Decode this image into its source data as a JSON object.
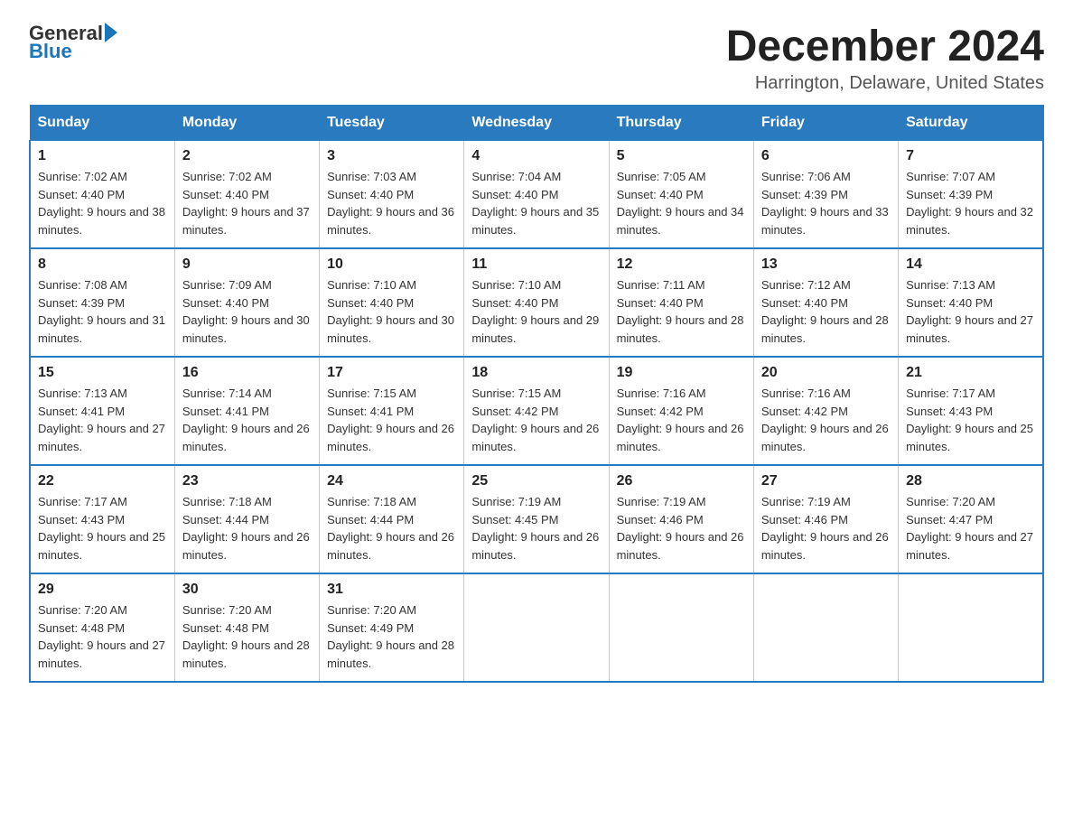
{
  "header": {
    "logo_general": "General",
    "logo_blue": "Blue",
    "month_title": "December 2024",
    "location": "Harrington, Delaware, United States"
  },
  "days_of_week": [
    "Sunday",
    "Monday",
    "Tuesday",
    "Wednesday",
    "Thursday",
    "Friday",
    "Saturday"
  ],
  "weeks": [
    [
      {
        "day": "1",
        "sunrise": "7:02 AM",
        "sunset": "4:40 PM",
        "daylight": "9 hours and 38 minutes."
      },
      {
        "day": "2",
        "sunrise": "7:02 AM",
        "sunset": "4:40 PM",
        "daylight": "9 hours and 37 minutes."
      },
      {
        "day": "3",
        "sunrise": "7:03 AM",
        "sunset": "4:40 PM",
        "daylight": "9 hours and 36 minutes."
      },
      {
        "day": "4",
        "sunrise": "7:04 AM",
        "sunset": "4:40 PM",
        "daylight": "9 hours and 35 minutes."
      },
      {
        "day": "5",
        "sunrise": "7:05 AM",
        "sunset": "4:40 PM",
        "daylight": "9 hours and 34 minutes."
      },
      {
        "day": "6",
        "sunrise": "7:06 AM",
        "sunset": "4:39 PM",
        "daylight": "9 hours and 33 minutes."
      },
      {
        "day": "7",
        "sunrise": "7:07 AM",
        "sunset": "4:39 PM",
        "daylight": "9 hours and 32 minutes."
      }
    ],
    [
      {
        "day": "8",
        "sunrise": "7:08 AM",
        "sunset": "4:39 PM",
        "daylight": "9 hours and 31 minutes."
      },
      {
        "day": "9",
        "sunrise": "7:09 AM",
        "sunset": "4:40 PM",
        "daylight": "9 hours and 30 minutes."
      },
      {
        "day": "10",
        "sunrise": "7:10 AM",
        "sunset": "4:40 PM",
        "daylight": "9 hours and 30 minutes."
      },
      {
        "day": "11",
        "sunrise": "7:10 AM",
        "sunset": "4:40 PM",
        "daylight": "9 hours and 29 minutes."
      },
      {
        "day": "12",
        "sunrise": "7:11 AM",
        "sunset": "4:40 PM",
        "daylight": "9 hours and 28 minutes."
      },
      {
        "day": "13",
        "sunrise": "7:12 AM",
        "sunset": "4:40 PM",
        "daylight": "9 hours and 28 minutes."
      },
      {
        "day": "14",
        "sunrise": "7:13 AM",
        "sunset": "4:40 PM",
        "daylight": "9 hours and 27 minutes."
      }
    ],
    [
      {
        "day": "15",
        "sunrise": "7:13 AM",
        "sunset": "4:41 PM",
        "daylight": "9 hours and 27 minutes."
      },
      {
        "day": "16",
        "sunrise": "7:14 AM",
        "sunset": "4:41 PM",
        "daylight": "9 hours and 26 minutes."
      },
      {
        "day": "17",
        "sunrise": "7:15 AM",
        "sunset": "4:41 PM",
        "daylight": "9 hours and 26 minutes."
      },
      {
        "day": "18",
        "sunrise": "7:15 AM",
        "sunset": "4:42 PM",
        "daylight": "9 hours and 26 minutes."
      },
      {
        "day": "19",
        "sunrise": "7:16 AM",
        "sunset": "4:42 PM",
        "daylight": "9 hours and 26 minutes."
      },
      {
        "day": "20",
        "sunrise": "7:16 AM",
        "sunset": "4:42 PM",
        "daylight": "9 hours and 26 minutes."
      },
      {
        "day": "21",
        "sunrise": "7:17 AM",
        "sunset": "4:43 PM",
        "daylight": "9 hours and 25 minutes."
      }
    ],
    [
      {
        "day": "22",
        "sunrise": "7:17 AM",
        "sunset": "4:43 PM",
        "daylight": "9 hours and 25 minutes."
      },
      {
        "day": "23",
        "sunrise": "7:18 AM",
        "sunset": "4:44 PM",
        "daylight": "9 hours and 26 minutes."
      },
      {
        "day": "24",
        "sunrise": "7:18 AM",
        "sunset": "4:44 PM",
        "daylight": "9 hours and 26 minutes."
      },
      {
        "day": "25",
        "sunrise": "7:19 AM",
        "sunset": "4:45 PM",
        "daylight": "9 hours and 26 minutes."
      },
      {
        "day": "26",
        "sunrise": "7:19 AM",
        "sunset": "4:46 PM",
        "daylight": "9 hours and 26 minutes."
      },
      {
        "day": "27",
        "sunrise": "7:19 AM",
        "sunset": "4:46 PM",
        "daylight": "9 hours and 26 minutes."
      },
      {
        "day": "28",
        "sunrise": "7:20 AM",
        "sunset": "4:47 PM",
        "daylight": "9 hours and 27 minutes."
      }
    ],
    [
      {
        "day": "29",
        "sunrise": "7:20 AM",
        "sunset": "4:48 PM",
        "daylight": "9 hours and 27 minutes."
      },
      {
        "day": "30",
        "sunrise": "7:20 AM",
        "sunset": "4:48 PM",
        "daylight": "9 hours and 28 minutes."
      },
      {
        "day": "31",
        "sunrise": "7:20 AM",
        "sunset": "4:49 PM",
        "daylight": "9 hours and 28 minutes."
      },
      null,
      null,
      null,
      null
    ]
  ],
  "labels": {
    "sunrise": "Sunrise:",
    "sunset": "Sunset:",
    "daylight": "Daylight:"
  },
  "colors": {
    "header_bg": "#2a7abf",
    "header_text": "#ffffff",
    "border": "#2a7abf"
  }
}
